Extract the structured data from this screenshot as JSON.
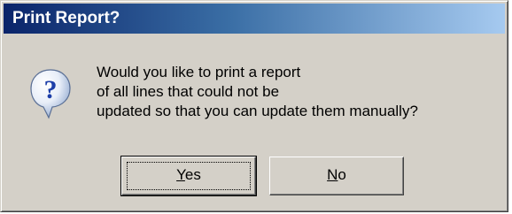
{
  "dialog": {
    "title": "Print Report?",
    "icon": "question-icon",
    "message_lines": [
      "Would you like to print a report",
      "of all lines that could not be",
      "updated so that you can update them manually?"
    ]
  },
  "buttons": {
    "yes": {
      "mnemonic": "Y",
      "rest": "es"
    },
    "no": {
      "mnemonic": "N",
      "rest": "o"
    }
  },
  "colors": {
    "dialog_face": "#d4d0c8",
    "title_start": "#0a246a",
    "title_end": "#a6caf0",
    "title_text": "#ffffff"
  }
}
